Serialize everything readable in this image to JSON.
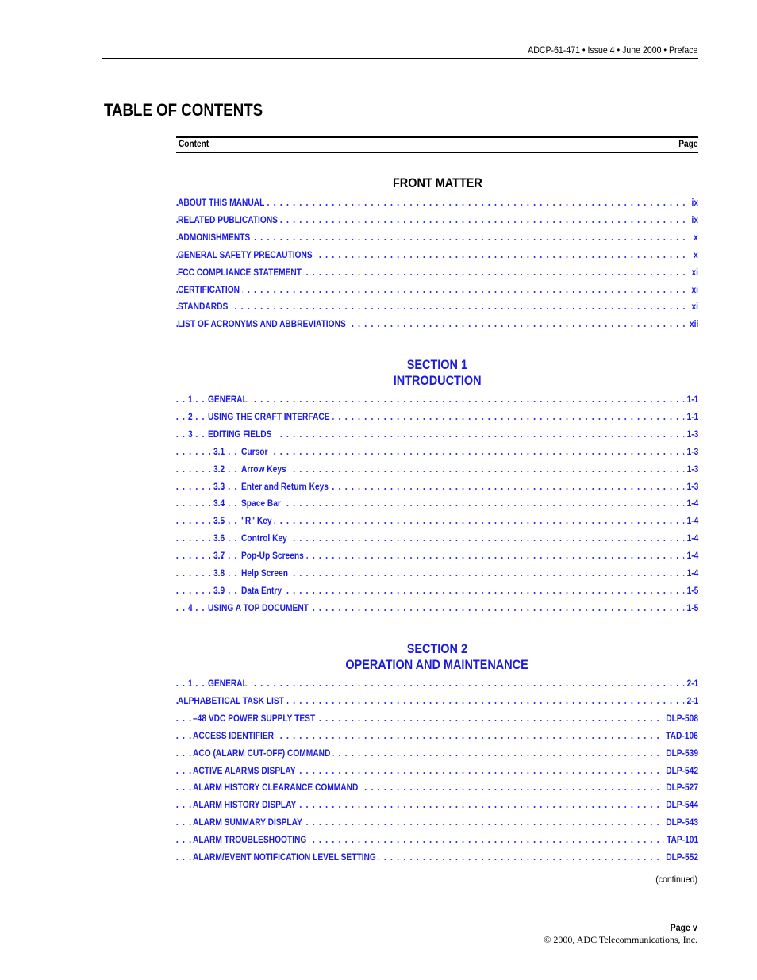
{
  "header": {
    "running_head": "ADCP-61-471 • Issue 4 • June 2000 • Preface"
  },
  "title": "TABLE OF CONTENTS",
  "columns": {
    "content": "Content",
    "page": "Page"
  },
  "front_matter": {
    "heading": "FRONT MATTER",
    "entries": [
      {
        "label": "ABOUT THIS MANUAL",
        "page": "ix"
      },
      {
        "label": "RELATED PUBLICATIONS",
        "page": "ix"
      },
      {
        "label": "ADMONISHMENTS",
        "page": "x"
      },
      {
        "label": "GENERAL SAFETY PRECAUTIONS",
        "page": "x"
      },
      {
        "label": "FCC COMPLIANCE STATEMENT",
        "page": "xi"
      },
      {
        "label": "CERTIFICATION",
        "page": "xi"
      },
      {
        "label": "STANDARDS",
        "page": "xi"
      },
      {
        "label": "LIST OF ACRONYMS AND ABBREVIATIONS",
        "page": "xii"
      }
    ]
  },
  "section1": {
    "heading_line1": "SECTION 1",
    "heading_line2": "INTRODUCTION",
    "entries": [
      {
        "num": "1",
        "label": "GENERAL",
        "page": "1-1"
      },
      {
        "num": "2",
        "label": "USING THE CRAFT INTERFACE",
        "page": "1-1"
      },
      {
        "num": "3",
        "label": "EDITING FIELDS",
        "page": "1-3"
      },
      {
        "num": "3.1",
        "label": "Cursor",
        "page": "1-3"
      },
      {
        "num": "3.2",
        "label": "Arrow Keys",
        "page": "1-3"
      },
      {
        "num": "3.3",
        "label": "Enter and Return Keys",
        "page": "1-3"
      },
      {
        "num": "3.4",
        "label": "Space Bar",
        "page": "1-4"
      },
      {
        "num": "3.5",
        "label": "\"R\" Key",
        "page": "1-4"
      },
      {
        "num": "3.6",
        "label": "Control Key",
        "page": "1-4"
      },
      {
        "num": "3.7",
        "label": "Pop-Up Screens",
        "page": "1-4"
      },
      {
        "num": "3.8",
        "label": "Help Screen",
        "page": "1-4"
      },
      {
        "num": "3.9",
        "label": "Data Entry",
        "page": "1-5"
      },
      {
        "num": "4",
        "label": "USING A TOP DOCUMENT",
        "page": "1-5"
      }
    ]
  },
  "section2": {
    "heading_line1": "SECTION 2",
    "heading_line2": "OPERATION AND MAINTENANCE",
    "entries": [
      {
        "num": "1",
        "label": "GENERAL",
        "page": "2-1"
      },
      {
        "num": "",
        "label": "ALPHABETICAL TASK LIST",
        "page": "2-1"
      },
      {
        "num": "",
        "label": "–48 VDC POWER SUPPLY TEST",
        "page": "DLP-508"
      },
      {
        "num": "",
        "label": "ACCESS IDENTIFIER",
        "page": "TAD-106"
      },
      {
        "num": "",
        "label": "ACO (ALARM CUT-OFF) COMMAND",
        "page": "DLP-539"
      },
      {
        "num": "",
        "label": "ACTIVE ALARMS DISPLAY",
        "page": "DLP-542"
      },
      {
        "num": "",
        "label": "ALARM HISTORY CLEARANCE COMMAND",
        "page": "DLP-527"
      },
      {
        "num": "",
        "label": "ALARM HISTORY DISPLAY",
        "page": "DLP-544"
      },
      {
        "num": "",
        "label": "ALARM SUMMARY DISPLAY",
        "page": "DLP-543"
      },
      {
        "num": "",
        "label": "ALARM TROUBLESHOOTING",
        "page": "TAP-101"
      },
      {
        "num": "",
        "label": "ALARM/EVENT NOTIFICATION LEVEL SETTING",
        "page": "DLP-552"
      }
    ]
  },
  "footer": {
    "continued": "(continued)",
    "page_number": "Page v",
    "copyright": "© 2000, ADC Telecommunications, Inc."
  }
}
